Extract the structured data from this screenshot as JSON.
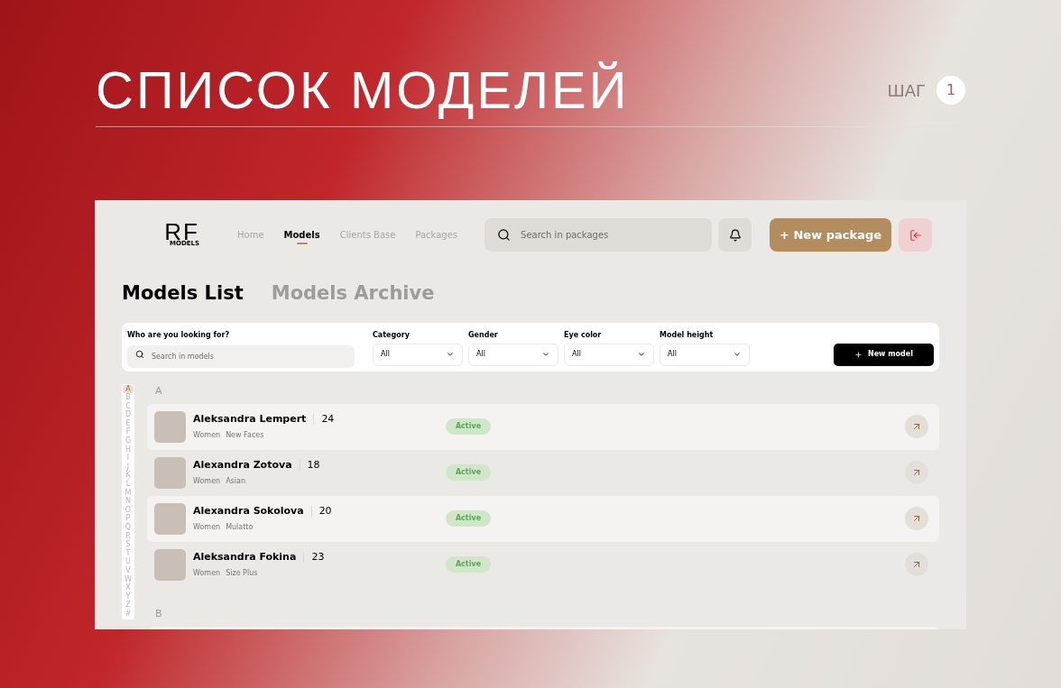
{
  "slide": {
    "title": "СПИСОК МОДЕЛЕЙ",
    "step_label": "ШАГ",
    "step_number": "1"
  },
  "app": {
    "logo": {
      "mark": "RF",
      "sub": "MODELS"
    },
    "nav": [
      {
        "label": "Home",
        "selected": false
      },
      {
        "label": "Models",
        "selected": true
      },
      {
        "label": "Clients Base",
        "selected": false
      },
      {
        "label": "Packages",
        "selected": false
      }
    ],
    "search": {
      "placeholder": "Search in packages"
    },
    "new_package_button": "+ New package",
    "tabs": [
      {
        "label": "Models List",
        "selected": true
      },
      {
        "label": "Models Archive",
        "selected": false
      }
    ],
    "filters": {
      "search_label": "Who are you looking for?",
      "search_placeholder": "Search in models",
      "selects": [
        {
          "label": "Category",
          "value": "All"
        },
        {
          "label": "Gender",
          "value": "All"
        },
        {
          "label": "Eye color",
          "value": "All"
        },
        {
          "label": "Model height",
          "value": "All"
        }
      ],
      "new_model_button": "New model"
    },
    "alphabet": [
      {
        "letter": "A",
        "selected": true
      },
      {
        "letter": "B",
        "selected": false
      },
      {
        "letter": "C",
        "selected": false
      },
      {
        "letter": "D",
        "selected": false
      },
      {
        "letter": "E",
        "selected": false
      },
      {
        "letter": "F",
        "selected": false
      },
      {
        "letter": "G",
        "selected": false
      },
      {
        "letter": "H",
        "selected": false
      },
      {
        "letter": "I",
        "selected": false
      },
      {
        "letter": "J",
        "selected": false
      },
      {
        "letter": "K",
        "selected": false
      },
      {
        "letter": "L",
        "selected": false
      },
      {
        "letter": "M",
        "selected": false
      },
      {
        "letter": "N",
        "selected": false
      },
      {
        "letter": "O",
        "selected": false
      },
      {
        "letter": "P",
        "selected": false
      },
      {
        "letter": "Q",
        "selected": false
      },
      {
        "letter": "R",
        "selected": false
      },
      {
        "letter": "S",
        "selected": false
      },
      {
        "letter": "T",
        "selected": false
      },
      {
        "letter": "U",
        "selected": false
      },
      {
        "letter": "V",
        "selected": false
      },
      {
        "letter": "W",
        "selected": false
      },
      {
        "letter": "X",
        "selected": false
      },
      {
        "letter": "Y",
        "selected": false
      },
      {
        "letter": "Z",
        "selected": false
      },
      {
        "letter": "#",
        "selected": false
      }
    ],
    "groups": [
      {
        "letter": "A",
        "models": [
          {
            "name": "Aleksandra Lempert",
            "age": "24",
            "gender": "Women",
            "category": "New Faces",
            "status": "Active"
          },
          {
            "name": "Alexandra Zotova",
            "age": "18",
            "gender": "Women",
            "category": "Asian",
            "status": "Active"
          },
          {
            "name": "Alexandra Sokolova",
            "age": "20",
            "gender": "Women",
            "category": "Mulatto",
            "status": "Active"
          },
          {
            "name": "Aleksandra Fokina",
            "age": "23",
            "gender": "Women",
            "category": "Size Plus",
            "status": "Active"
          }
        ]
      },
      {
        "letter": "B"
      }
    ]
  }
}
